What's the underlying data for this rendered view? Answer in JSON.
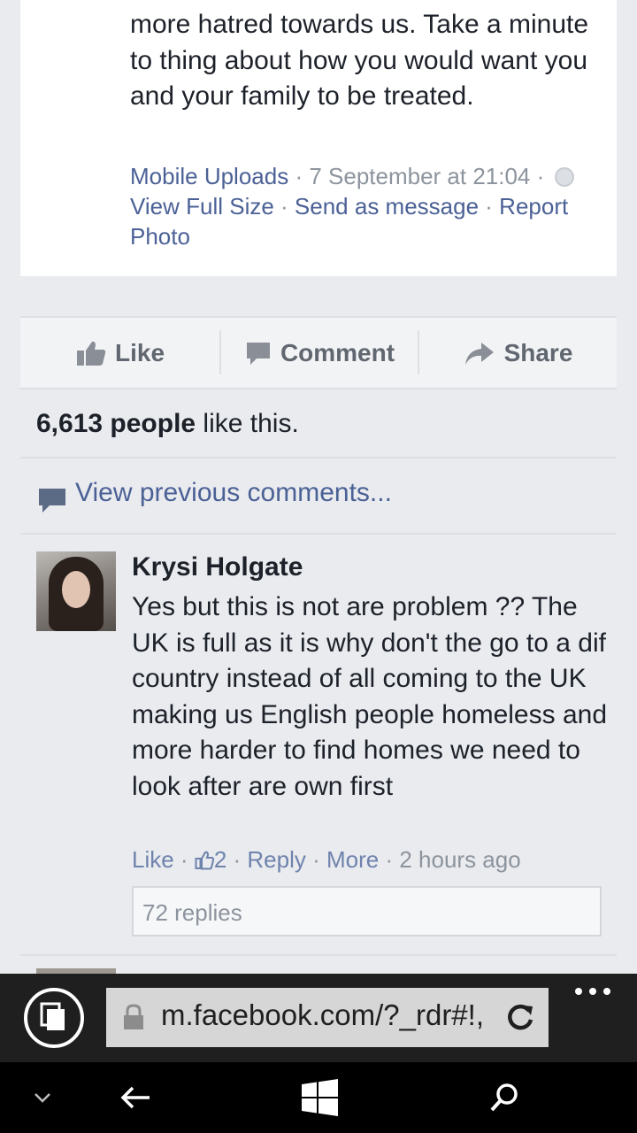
{
  "post": {
    "text": "more hatred towards us. Take a minute to thing about how you would want you and your family to be treated.",
    "source": "Mobile Uploads",
    "sep1": " · ",
    "date": "7 September at 21:04",
    "sep2": " · ",
    "view_full_size": "View Full Size",
    "sep3": " · ",
    "send_as_message": "Send as message",
    "sep4": " · ",
    "report_photo": "Report Photo",
    "privacy_icon": "globe-icon"
  },
  "actions": {
    "like": "Like",
    "comment": "Comment",
    "share": "Share"
  },
  "likes": {
    "count": "6,613 people",
    "suffix": " like this."
  },
  "comments": {
    "view_previous": "View previous comments...",
    "items": [
      {
        "author": "Krysi Holgate",
        "text": "Yes but this is not are problem ?? The UK is full as it is why don't the go to a dif country instead of all coming to the UK making us English people homeless and more harder to find homes we need to look after are own first",
        "like_label": "Like",
        "dot1": " · ",
        "like_count": "2",
        "dot2": " · ",
        "reply_label": "Reply",
        "dot3": " · ",
        "more_label": "More",
        "dot4": " · ",
        "time": "2 hours ago",
        "replies": "72 replies"
      }
    ]
  },
  "browser": {
    "url": "m.facebook.com/?_rdr#!,",
    "icons": [
      "tabs-icon",
      "lock-icon",
      "refresh-icon",
      "more-icon"
    ]
  },
  "nav": {
    "icons": [
      "chevron-down-icon",
      "back-icon",
      "windows-icon",
      "search-icon"
    ]
  },
  "colors": {
    "link": "#4b6196",
    "background": "#e9ebee",
    "browser_bar": "#1f1f1f"
  }
}
